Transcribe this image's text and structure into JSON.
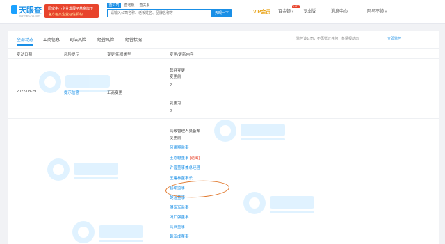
{
  "header": {
    "logo_text": "天眼查",
    "logo_sub": "TianYanCha.com",
    "promo_line1": "国家中小企业发展子基金旗下",
    "promo_line2": "官方备案企业征信机构",
    "search_tabs": [
      "查公司",
      "查老板",
      "查关系"
    ],
    "search_placeholder": "请输入公司名称、老板姓名、品牌名称等",
    "search_button": "天眼一下",
    "vip_label": "VIP会员",
    "hot_badge": "HOT",
    "nav_items": [
      "百金顿",
      "专业版",
      "消息中心",
      "阿乌不帅"
    ]
  },
  "card": {
    "tabs": [
      "全部动态",
      "工商信息",
      "司法风险",
      "经营风险",
      "经营状况"
    ],
    "note": "监控该公司，不再错过任何一条情报动态",
    "note_link": "立即监控",
    "columns": [
      "变动日期",
      "风险提示",
      "变更/新增类型",
      "变更/更新内容"
    ]
  },
  "records": {
    "r1": {
      "date": "2022-08-29",
      "risk": "提示信息",
      "type": "工商变更",
      "lines": [
        "营经变更",
        "变更前",
        "2",
        "变更为",
        "2"
      ]
    },
    "r2": {
      "lines": [
        "高级管理人员备案",
        "变更前",
        "何禹翔监事",
        "王恩聪董事 [退出]",
        "许晋董事兼总经理",
        "王建林董事长",
        "鹤瑜监事",
        "鲍溢董事",
        "傅淦军监事",
        "冯广强董事",
        "高岚董事",
        "黄亚成董事"
      ]
    }
  },
  "watermark": {
    "text": "天眼查",
    "sub": "TianYanCha.com"
  },
  "colors": {
    "brand": "#1a8fe6",
    "promo": "#e8442c",
    "vip": "#e8a317",
    "annotation": "#e0762a"
  },
  "icons": {
    "logo": "tianyancha-logo-icon",
    "chevron": "chevron-down-icon"
  }
}
